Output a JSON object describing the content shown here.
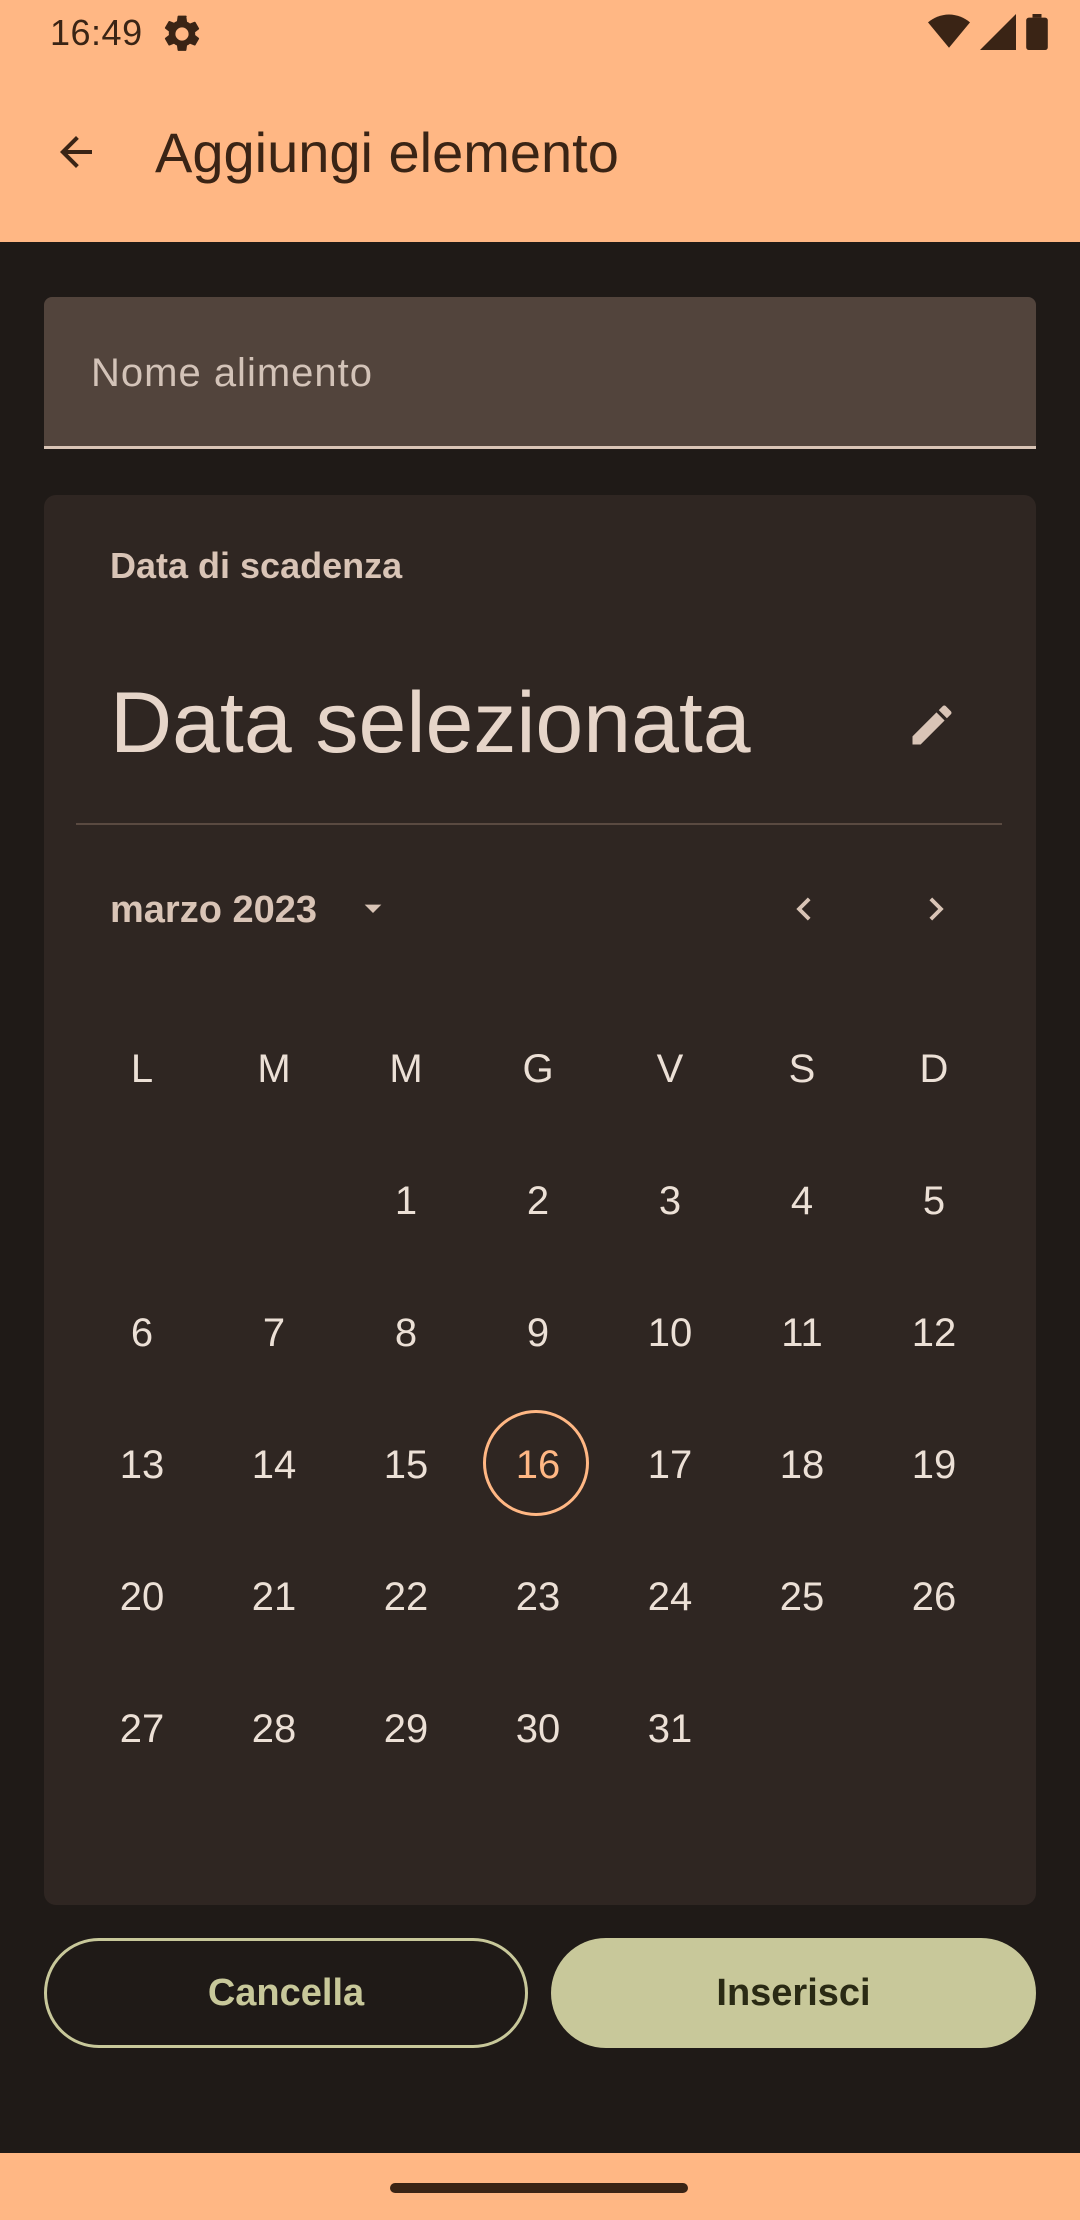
{
  "status_bar": {
    "time": "16:49"
  },
  "app_bar": {
    "title": "Aggiungi elemento"
  },
  "form": {
    "name_placeholder": "Nome alimento",
    "name_value": ""
  },
  "date_picker": {
    "label": "Data di scadenza",
    "headline": "Data selezionata",
    "month_year": "marzo 2023",
    "weekdays": [
      "L",
      "M",
      "M",
      "G",
      "V",
      "S",
      "D"
    ],
    "weeks": [
      [
        "",
        "",
        "1",
        "2",
        "3",
        "4",
        "5"
      ],
      [
        "6",
        "7",
        "8",
        "9",
        "10",
        "11",
        "12"
      ],
      [
        "13",
        "14",
        "15",
        "16",
        "17",
        "18",
        "19"
      ],
      [
        "20",
        "21",
        "22",
        "23",
        "24",
        "25",
        "26"
      ],
      [
        "27",
        "28",
        "29",
        "30",
        "31",
        "",
        ""
      ]
    ],
    "today": "16"
  },
  "actions": {
    "cancel_label": "Cancella",
    "insert_label": "Inserisci"
  },
  "icons": {
    "settings": "gear-icon",
    "wifi": "wifi-icon",
    "signal": "signal-icon",
    "battery": "battery-icon",
    "back": "arrow-back-icon",
    "edit": "pencil-icon",
    "dropdown": "dropdown-arrow-icon",
    "prev": "chevron-left-icon",
    "next": "chevron-right-icon"
  },
  "colors": {
    "accent": "#ffb784",
    "button": "#c8c89a",
    "background": "#1f1a17",
    "surface": "#2f2622"
  }
}
